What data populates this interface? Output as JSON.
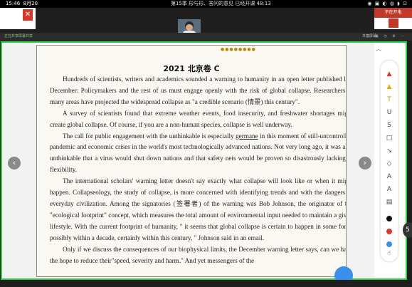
{
  "status_bar": {
    "time": "15:46",
    "date": "8月20",
    "meeting_info": "第15季 形与形、答问的意见   已经开课 48:13",
    "right_icons": "◉ ▣ ◐ ◍ ◗ ⊡"
  },
  "meeting": {
    "share_label": "正在共享屏幕共享",
    "participant_name": "我",
    "toolbar_right": "共享屏幕",
    "toolbar_icons": "▢ ▣ ◷ ⊕ ⋯",
    "bg_app_right_tab": "不在开电"
  },
  "document": {
    "page_dots": "●●●●●●●●",
    "title": "2021 北京卷 C",
    "paragraphs": [
      {
        "before": "Hundreds of scientists, writers and academics sounded a warning to humanity in an open letter published last December: Policymakers and the rest of us must engage openly with the risk of global collapse. Researchers in many areas have projected the widespread collapse as \"a credible scenario (情景) this century\".",
        "underlined": "",
        "after": ""
      },
      {
        "before": "A survey of scientists found that extreme weather events, food insecurity, and freshwater shortages might create global collapse. Of course, if you are a non-human species, collapse is well underway.",
        "underlined": "",
        "after": ""
      },
      {
        "before": "The call for public engagement with the unthinkable is especially ",
        "underlined": "germane",
        "after": " in this moment of still-uncontrolled pandemic and economic crises in the world's most technologically advanced nations. Not very long ago, it was also unthinkable that a virus would shut down nations and that safety nets would be proven so disastrously lacking in flexibility."
      },
      {
        "before": "The international scholars' warning letter doesn't say exactly what collapse will look like or when it might happen. Collapseology, the study of collapse, is more concerned with identifying trends and with the dangers of everyday civilization. Among the signatories (签署者) of the warning was Bob Johnson, the originator of the \"ecological footprint\" concept, which measures the total amount of environmental input needed to maintain a given lifestyle. With the current footprint of humanity, \" it seems that global collapse is certain to happen in some form, possibly within a decade, certainly within this century, \" Johnson said in an email.",
        "underlined": "",
        "after": ""
      },
      {
        "before": "Only if we discuss the consequences of our biophysical limits, the December warning letter says, can we have the hope to reduce their\"speed, severity and harm.\" And yet messengers of the",
        "underlined": "",
        "after": ""
      }
    ]
  },
  "navigation": {
    "prev_icon": "‹",
    "next_icon": "›"
  },
  "annotation_tools": {
    "tools": [
      {
        "name": "marker-red-icon",
        "glyph": "▲"
      },
      {
        "name": "marker-yellow-icon",
        "glyph": "▲"
      },
      {
        "name": "text-tool-icon",
        "glyph": "T"
      },
      {
        "name": "underline-tool-icon",
        "glyph": "U"
      },
      {
        "name": "strikethrough-tool-icon",
        "glyph": "S"
      },
      {
        "name": "rectangle-tool-icon",
        "glyph": "□"
      },
      {
        "name": "arrow-tool-icon",
        "glyph": "↘"
      },
      {
        "name": "eraser-tool-icon",
        "glyph": "◇"
      },
      {
        "name": "text-a-tool-icon",
        "glyph": "A"
      },
      {
        "name": "highlight-a-tool-icon",
        "glyph": "A"
      },
      {
        "name": "comment-tool-icon",
        "glyph": "▤"
      }
    ],
    "colors": [
      "#111111",
      "#d43a2f",
      "#3a8fe8"
    ],
    "hand_icon": "☝"
  }
}
